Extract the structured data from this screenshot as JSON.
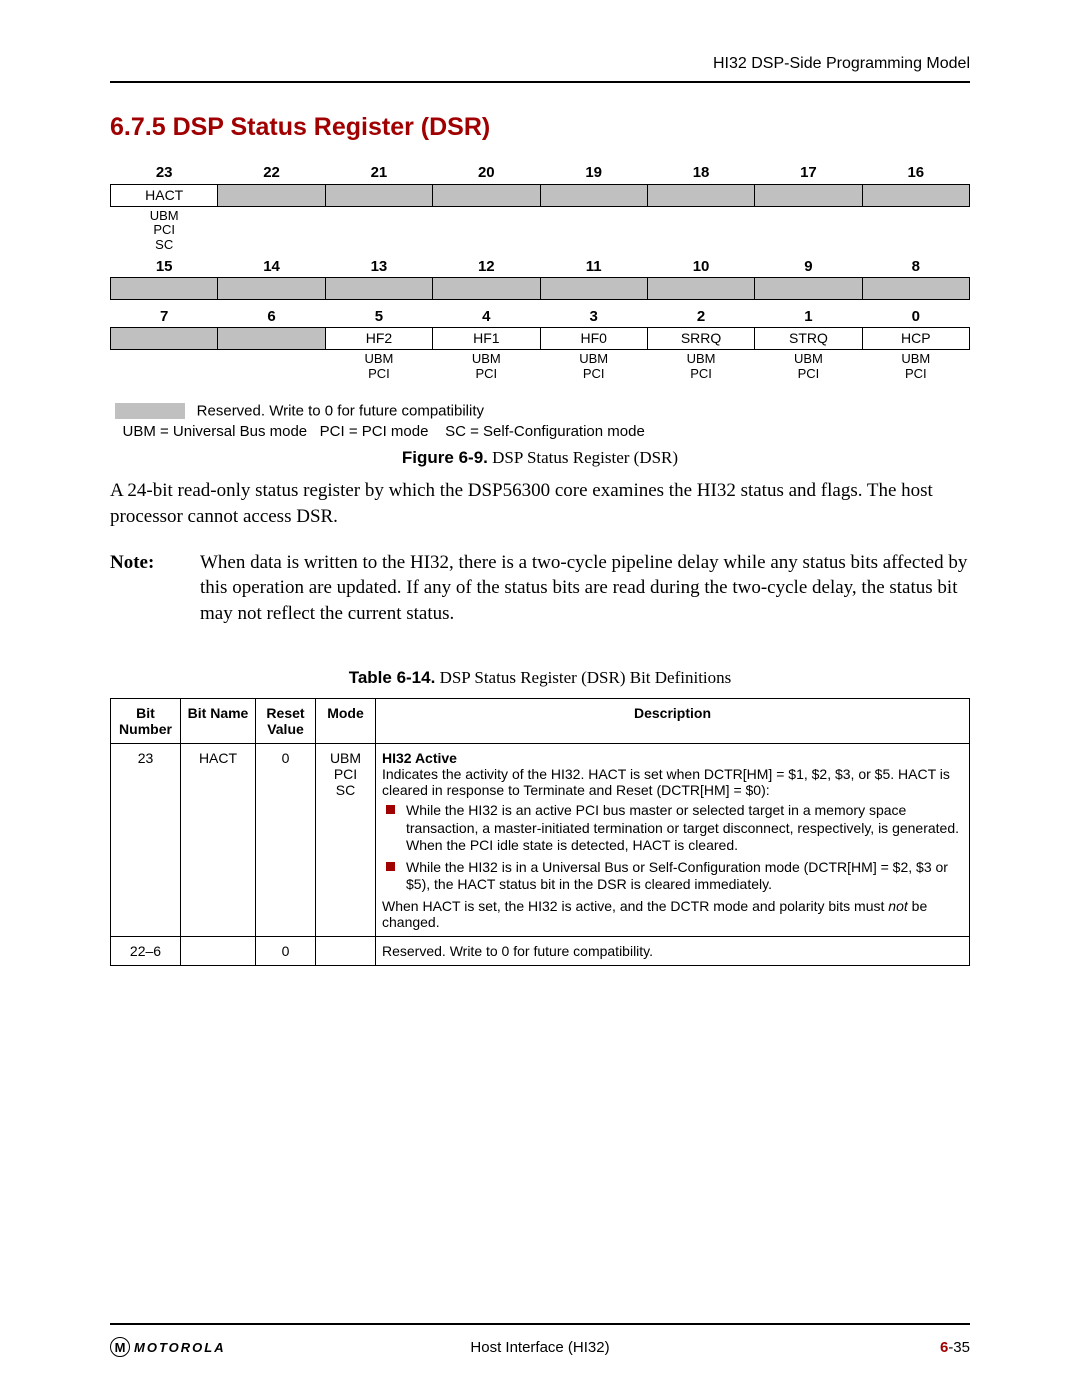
{
  "header": {
    "right": "HI32 DSP-Side Programming Model"
  },
  "section": {
    "number": "6.7.5",
    "title": "DSP Status Register (DSR)"
  },
  "register": {
    "row1_bits": [
      "23",
      "22",
      "21",
      "20",
      "19",
      "18",
      "17",
      "16"
    ],
    "row1_names": [
      "HACT",
      "",
      "",
      "",
      "",
      "",
      "",
      ""
    ],
    "row1_modes": [
      [
        "UBM",
        "PCI",
        "SC"
      ],
      [],
      [],
      [],
      [],
      [],
      [],
      []
    ],
    "row2_bits": [
      "15",
      "14",
      "13",
      "12",
      "11",
      "10",
      "9",
      "8"
    ],
    "row3_bits": [
      "7",
      "6",
      "5",
      "4",
      "3",
      "2",
      "1",
      "0"
    ],
    "row3_names": [
      "",
      "",
      "HF2",
      "HF1",
      "HF0",
      "SRRQ",
      "STRQ",
      "HCP"
    ],
    "row3_modes": [
      [],
      [],
      [
        "UBM",
        "PCI"
      ],
      [
        "UBM",
        "PCI"
      ],
      [
        "UBM",
        "PCI"
      ],
      [
        "UBM",
        "PCI"
      ],
      [
        "UBM",
        "PCI"
      ],
      [
        "UBM",
        "PCI"
      ]
    ]
  },
  "legend": {
    "reserved_text": "Reserved. Write to 0 for future compatibility",
    "modes_text": "UBM = Universal Bus mode   PCI = PCI mode    SC = Self-Configuration mode"
  },
  "figure_caption": {
    "label": "Figure 6-9.",
    "text": "DSP Status Register (DSR)"
  },
  "body_para": "A 24-bit read-only status register by which the DSP56300 core examines the HI32 status and flags. The host processor cannot access DSR.",
  "note": {
    "label": "Note:",
    "text": "When data is written to the HI32, there is a two-cycle pipeline delay while any status bits affected by this operation are updated. If any of the status bits are read during the two-cycle delay, the status bit may not reflect the current status."
  },
  "table_caption": {
    "label": "Table 6-14.",
    "text": "DSP Status Register (DSR) Bit Definitions"
  },
  "def_table": {
    "headers": [
      "Bit Number",
      "Bit Name",
      "Reset Value",
      "Mode",
      "Description"
    ],
    "rows": [
      {
        "bitnum": "23",
        "bitname": "HACT",
        "reset": "0",
        "mode": [
          "UBM",
          "PCI",
          "SC"
        ],
        "desc_title": "HI32 Active",
        "desc_intro": "Indicates the activity of the HI32. HACT is set when DCTR[HM] = $1, $2, $3, or $5. HACT is cleared in response to Terminate and Reset (DCTR[HM] = $0):",
        "desc_bullets": [
          "While the HI32 is an active PCI bus master or selected target in a memory space transaction, a master-initiated termination or target disconnect, respectively, is generated. When the PCI idle state is detected, HACT is cleared.",
          "While the HI32 is in a Universal Bus or Self-Configuration mode (DCTR[HM] = $2, $3 or $5), the HACT status bit in the DSR is cleared immediately."
        ],
        "desc_outro_pre": "When HACT is set, the HI32 is active, and the DCTR mode and polarity bits must ",
        "desc_outro_em": "not",
        "desc_outro_post": " be changed."
      },
      {
        "bitnum": "22–6",
        "bitname": "",
        "reset": "0",
        "mode": [],
        "desc_plain": "Reserved. Write to 0 for future compatibility."
      }
    ]
  },
  "footer": {
    "center": "Host Interface (HI32)",
    "page_prefix": "6",
    "page_suffix": "-35",
    "logo_letters": "M",
    "logo_word": "MOTOROLA"
  }
}
